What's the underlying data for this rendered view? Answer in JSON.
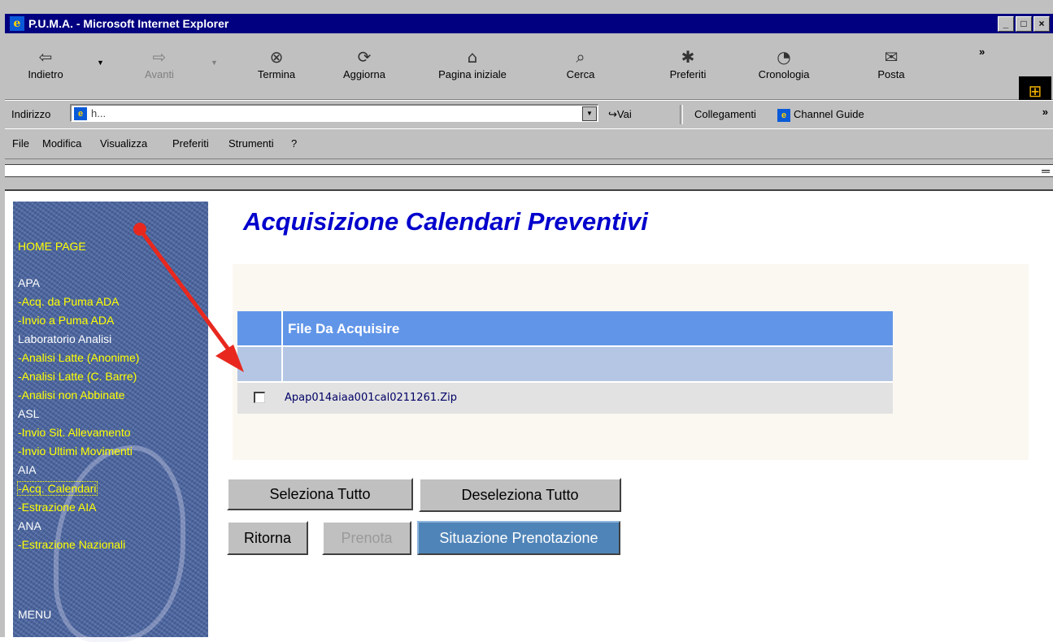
{
  "window": {
    "title": "P.U.M.A. - Microsoft Internet Explorer",
    "controls": [
      "_",
      "□",
      "×"
    ]
  },
  "toolbar": {
    "buttons": [
      {
        "label": "Indietro",
        "icon": "back-arrow-icon",
        "glyph": "⇦"
      },
      {
        "label": "Avanti",
        "icon": "forward-arrow-icon",
        "glyph": "⇨"
      },
      {
        "label": "Termina",
        "icon": "stop-icon",
        "glyph": "⊗"
      },
      {
        "label": "Aggiorna",
        "icon": "refresh-icon",
        "glyph": "⟳"
      },
      {
        "label": "Pagina iniziale",
        "icon": "home-icon",
        "glyph": "⌂"
      },
      {
        "label": "Cerca",
        "icon": "search-icon",
        "glyph": "⌕"
      },
      {
        "label": "Preferiti",
        "icon": "favorites-icon",
        "glyph": "✱"
      },
      {
        "label": "Cronologia",
        "icon": "history-icon",
        "glyph": "◔"
      },
      {
        "label": "Posta",
        "icon": "mail-icon",
        "glyph": "✉"
      }
    ],
    "more": "»"
  },
  "address": {
    "label": "Indirizzo",
    "url": "h...",
    "go_label": "Vai",
    "links_label": "Collegamenti",
    "channel_label": "Channel Guide",
    "more": "»"
  },
  "menu": {
    "items": [
      "File",
      "Modifica",
      "Visualizza",
      "Preferiti",
      "Strumenti",
      "?"
    ]
  },
  "sidebar": {
    "home": "HOME PAGE",
    "sections": [
      {
        "title": "APA",
        "items": [
          "-Acq. da Puma ADA",
          "-Invio a Puma ADA"
        ]
      },
      {
        "title": "Laboratorio Analisi",
        "items": [
          "-Analisi Latte (Anonime)",
          "-Analisi Latte (C. Barre)",
          "-Analisi non Abbinate"
        ]
      },
      {
        "title": "ASL",
        "items": [
          "-Invio Sit. Allevamento",
          "-Invio Ultimi Movimenti"
        ]
      },
      {
        "title": "AIA",
        "items": [
          "-Acq. Calendari",
          "-Estrazione AIA"
        ]
      },
      {
        "title": "ANA",
        "items": [
          "-Estrazione Nazionali"
        ]
      }
    ],
    "footer": "MENU"
  },
  "main": {
    "title": "Acquisizione Calendari Preventivi",
    "table": {
      "header": "File Da Acquisire",
      "rows": [
        {
          "checked": false,
          "filename": "Apap014aiaa001cal0211261.Zip"
        }
      ]
    },
    "buttons": {
      "select_all": "Seleziona Tutto",
      "deselect_all": "Deseleziona Tutto",
      "back": "Ritorna",
      "book": "Prenota",
      "booking_status": "Situazione Prenotazione"
    }
  },
  "colors": {
    "title_bar": "#000080",
    "page_title": "#0000cc",
    "table_header": "#6195e8",
    "table_subheader": "#b4c6e4",
    "sidebar_link": "#ffff00",
    "annotation_arrow": "#e8281e"
  }
}
